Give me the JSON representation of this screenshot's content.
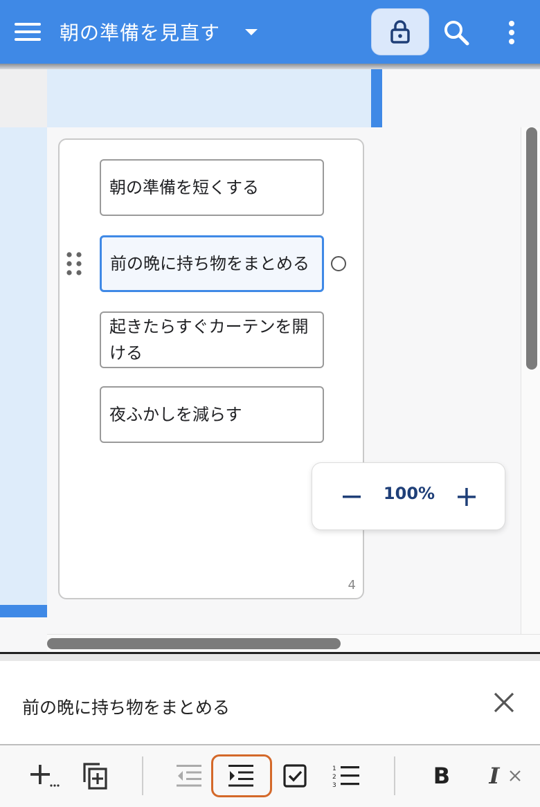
{
  "header": {
    "title": "朝の準備を見直す",
    "icons": {
      "menu": "hamburger-menu-icon",
      "caret": "chevron-down-icon",
      "lock": "lock-icon",
      "search": "search-icon",
      "more": "more-vertical-icon"
    }
  },
  "colors": {
    "accent": "#3f89e6",
    "selection": "#deecfa",
    "zoom_text": "#1f3f78",
    "active_tool_border": "#d4692a"
  },
  "mindmap": {
    "nodes": [
      {
        "label": "朝の準備を短くする",
        "selected": false
      },
      {
        "label": "前の晩に持ち物をまとめる",
        "selected": true
      },
      {
        "label": "起きたらすぐカーテンを開ける",
        "selected": false
      },
      {
        "label": "夜ふかしを減らす",
        "selected": false
      }
    ],
    "count": "4"
  },
  "zoom": {
    "level": "100%"
  },
  "editor": {
    "text": "前の晩に持ち物をまとめる"
  },
  "toolbar": {
    "tools": [
      "add-more",
      "duplicate",
      "outdent",
      "indent",
      "checkbox",
      "numbered-list",
      "bold",
      "italic"
    ],
    "bold_label": "B",
    "italic_label": "I",
    "active": "indent"
  }
}
